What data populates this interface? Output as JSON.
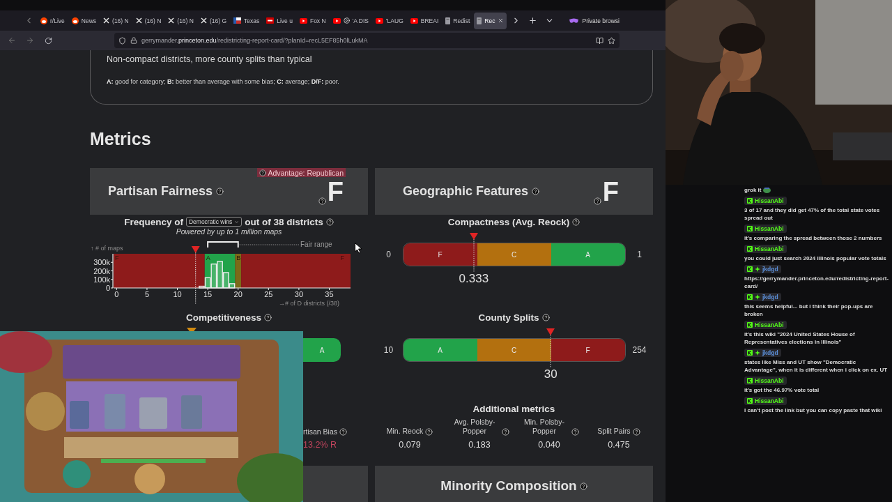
{
  "browser": {
    "tabs": [
      {
        "label": "r/Live",
        "kind": "reddit",
        "playing": false,
        "selected": false
      },
      {
        "label": "News",
        "kind": "reddit",
        "playing": false,
        "selected": false
      },
      {
        "label": "(16) N",
        "kind": "x",
        "playing": false,
        "selected": false
      },
      {
        "label": "(16) N",
        "kind": "x",
        "playing": false,
        "selected": false
      },
      {
        "label": "(16) N",
        "kind": "x",
        "playing": false,
        "selected": false
      },
      {
        "label": "(16) G",
        "kind": "x",
        "playing": false,
        "selected": false
      },
      {
        "label": "Texas",
        "kind": "flag",
        "playing": false,
        "selected": false
      },
      {
        "label": "Live u",
        "kind": "tile",
        "playing": false,
        "selected": false
      },
      {
        "label": "Fox N",
        "kind": "video",
        "playing": false,
        "selected": false
      },
      {
        "label": "'A DIS",
        "kind": "video",
        "playing": true,
        "selected": false
      },
      {
        "label": "'LAUG",
        "kind": "video",
        "playing": false,
        "selected": false
      },
      {
        "label": "BREAI",
        "kind": "video",
        "playing": false,
        "selected": false
      },
      {
        "label": "Redist",
        "kind": "page",
        "playing": false,
        "selected": false
      },
      {
        "label": "Rec",
        "kind": "page",
        "playing": false,
        "selected": true
      }
    ],
    "private_label": "Private browsi",
    "url": {
      "subdomain": "gerrymander.",
      "domain": "princeton.edu",
      "path": "/redistricting-report-card/?planId=recL5EF85h0lLukMA"
    }
  },
  "summary": {
    "description": "Non-compact districts, more county splits than typical",
    "legend": "**A:** good for category; **B:** better than average with some bias; **C:** average; **D/F:** poor."
  },
  "heading": "Metrics",
  "partisan": {
    "title": "Partisan Fairness",
    "grade": "F",
    "advantage": "Advantage: Republican",
    "chart_title_before": "Frequency of",
    "dropdown": {
      "value": "Democratic wins"
    },
    "chart_title_after": "out of 38 districts",
    "subtitle": "Powered by up to 1 million maps",
    "chart_data": {
      "type": "bar",
      "xlabel": "→# of D districts (/38)",
      "ylabel": "↑ # of maps",
      "x": [
        14,
        15,
        16,
        17,
        18,
        19
      ],
      "values": [
        20000,
        120000,
        280000,
        310000,
        180000,
        50000
      ],
      "xlim": [
        -0.5,
        38.5
      ],
      "ylim": [
        0,
        400000
      ],
      "xticks": [
        0,
        5,
        10,
        15,
        20,
        25,
        30,
        35
      ],
      "yticks": [
        {
          "value": 0,
          "label": "0"
        },
        {
          "value": 100000,
          "label": "100k"
        },
        {
          "value": 200000,
          "label": "200k"
        },
        {
          "value": 300000,
          "label": "300k"
        }
      ]
    },
    "grade_zones": [
      {
        "label": "F",
        "color": "#8e1b1b"
      },
      {
        "label": "A",
        "color": "#22a34a"
      },
      {
        "label": "B",
        "color": "#7c6a18"
      },
      {
        "label": "F",
        "color": "#8e1b1b"
      }
    ],
    "fair_range_label": "Fair range",
    "competitiveness": {
      "title": "Competitiveness",
      "segments": [
        {
          "label": "A",
          "color": "#22a34a"
        }
      ]
    },
    "bias": {
      "label": "rtisan Bias",
      "value": "13.2% R"
    }
  },
  "geographic": {
    "title": "Geographic Features",
    "grade": "F",
    "meters": [
      {
        "title": "Compactness (Avg. Reock)",
        "min": "0",
        "max": "1",
        "value": "0.333",
        "level": 0.32,
        "segments": [
          {
            "label": "F",
            "color": "#8e1b1b"
          },
          {
            "label": "C",
            "color": "#b3700f"
          },
          {
            "label": "A",
            "color": "#22a34a"
          }
        ]
      },
      {
        "title": "County Splits",
        "min": "10",
        "max": "254",
        "value": "30",
        "level": 0.665,
        "segments": [
          {
            "label": "A",
            "color": "#22a34a"
          },
          {
            "label": "C",
            "color": "#b3700f"
          },
          {
            "label": "F",
            "color": "#8e1b1b"
          }
        ]
      }
    ],
    "additional_title": "Additional metrics",
    "additional": [
      {
        "label": "Min. Reock",
        "value": "0.079"
      },
      {
        "label": "Avg. Polsby-Popper",
        "value": "0.183"
      },
      {
        "label": "Min. Polsby-Popper",
        "value": "0.040"
      },
      {
        "label": "Split Pairs",
        "value": "0.475"
      }
    ]
  },
  "next_section": {
    "title": "Minority Composition"
  },
  "chat": {
    "messages": [
      {
        "kind": "continuation",
        "text": "grok it"
      },
      {
        "kind": "message",
        "user": "HissanAbi",
        "color": "#53fc18",
        "badges": [
          {
            "kind": "k"
          }
        ],
        "text": "3 of 17 and they did get 47% of the total state votes spread out"
      },
      {
        "kind": "message",
        "user": "HissanAbi",
        "color": "#53fc18",
        "badges": [
          {
            "kind": "k"
          }
        ],
        "text": "it's comparing the spread between those 2 numbers"
      },
      {
        "kind": "message",
        "user": "HissanAbi",
        "color": "#53fc18",
        "badges": [
          {
            "kind": "k"
          }
        ],
        "text": "you could just search 2024 Illinois popular vote totals"
      },
      {
        "kind": "message",
        "user": "jkdgd",
        "color": "#5b8fd9",
        "badges": [
          {
            "kind": "k"
          },
          {
            "kind": "star"
          }
        ],
        "text": "https://gerrymander.princeton.edu/redistricting-report-card/"
      },
      {
        "kind": "message",
        "user": "jkdgd",
        "color": "#5b8fd9",
        "badges": [
          {
            "kind": "k"
          },
          {
            "kind": "star"
          }
        ],
        "text": "this seems helpful... but I think their pop-ups are broken"
      },
      {
        "kind": "message",
        "user": "HissanAbi",
        "color": "#53fc18",
        "badges": [
          {
            "kind": "k"
          }
        ],
        "text": "it's this wiki \"2024 United States House of Representatives elections in Illinois\""
      },
      {
        "kind": "message",
        "user": "jkdgd",
        "color": "#5b8fd9",
        "badges": [
          {
            "kind": "k"
          },
          {
            "kind": "star"
          }
        ],
        "text": "states like Miss and UT show \"Democratic Advantage\", when it is different when i click on ex. UT"
      },
      {
        "kind": "message",
        "user": "HissanAbi",
        "color": "#53fc18",
        "badges": [
          {
            "kind": "k"
          }
        ],
        "text": "it's got the 46.97% vote total"
      },
      {
        "kind": "message",
        "user": "HissanAbi",
        "color": "#53fc18",
        "badges": [
          {
            "kind": "k"
          }
        ],
        "text": "I can't post the link but you can copy paste that wiki"
      }
    ]
  }
}
